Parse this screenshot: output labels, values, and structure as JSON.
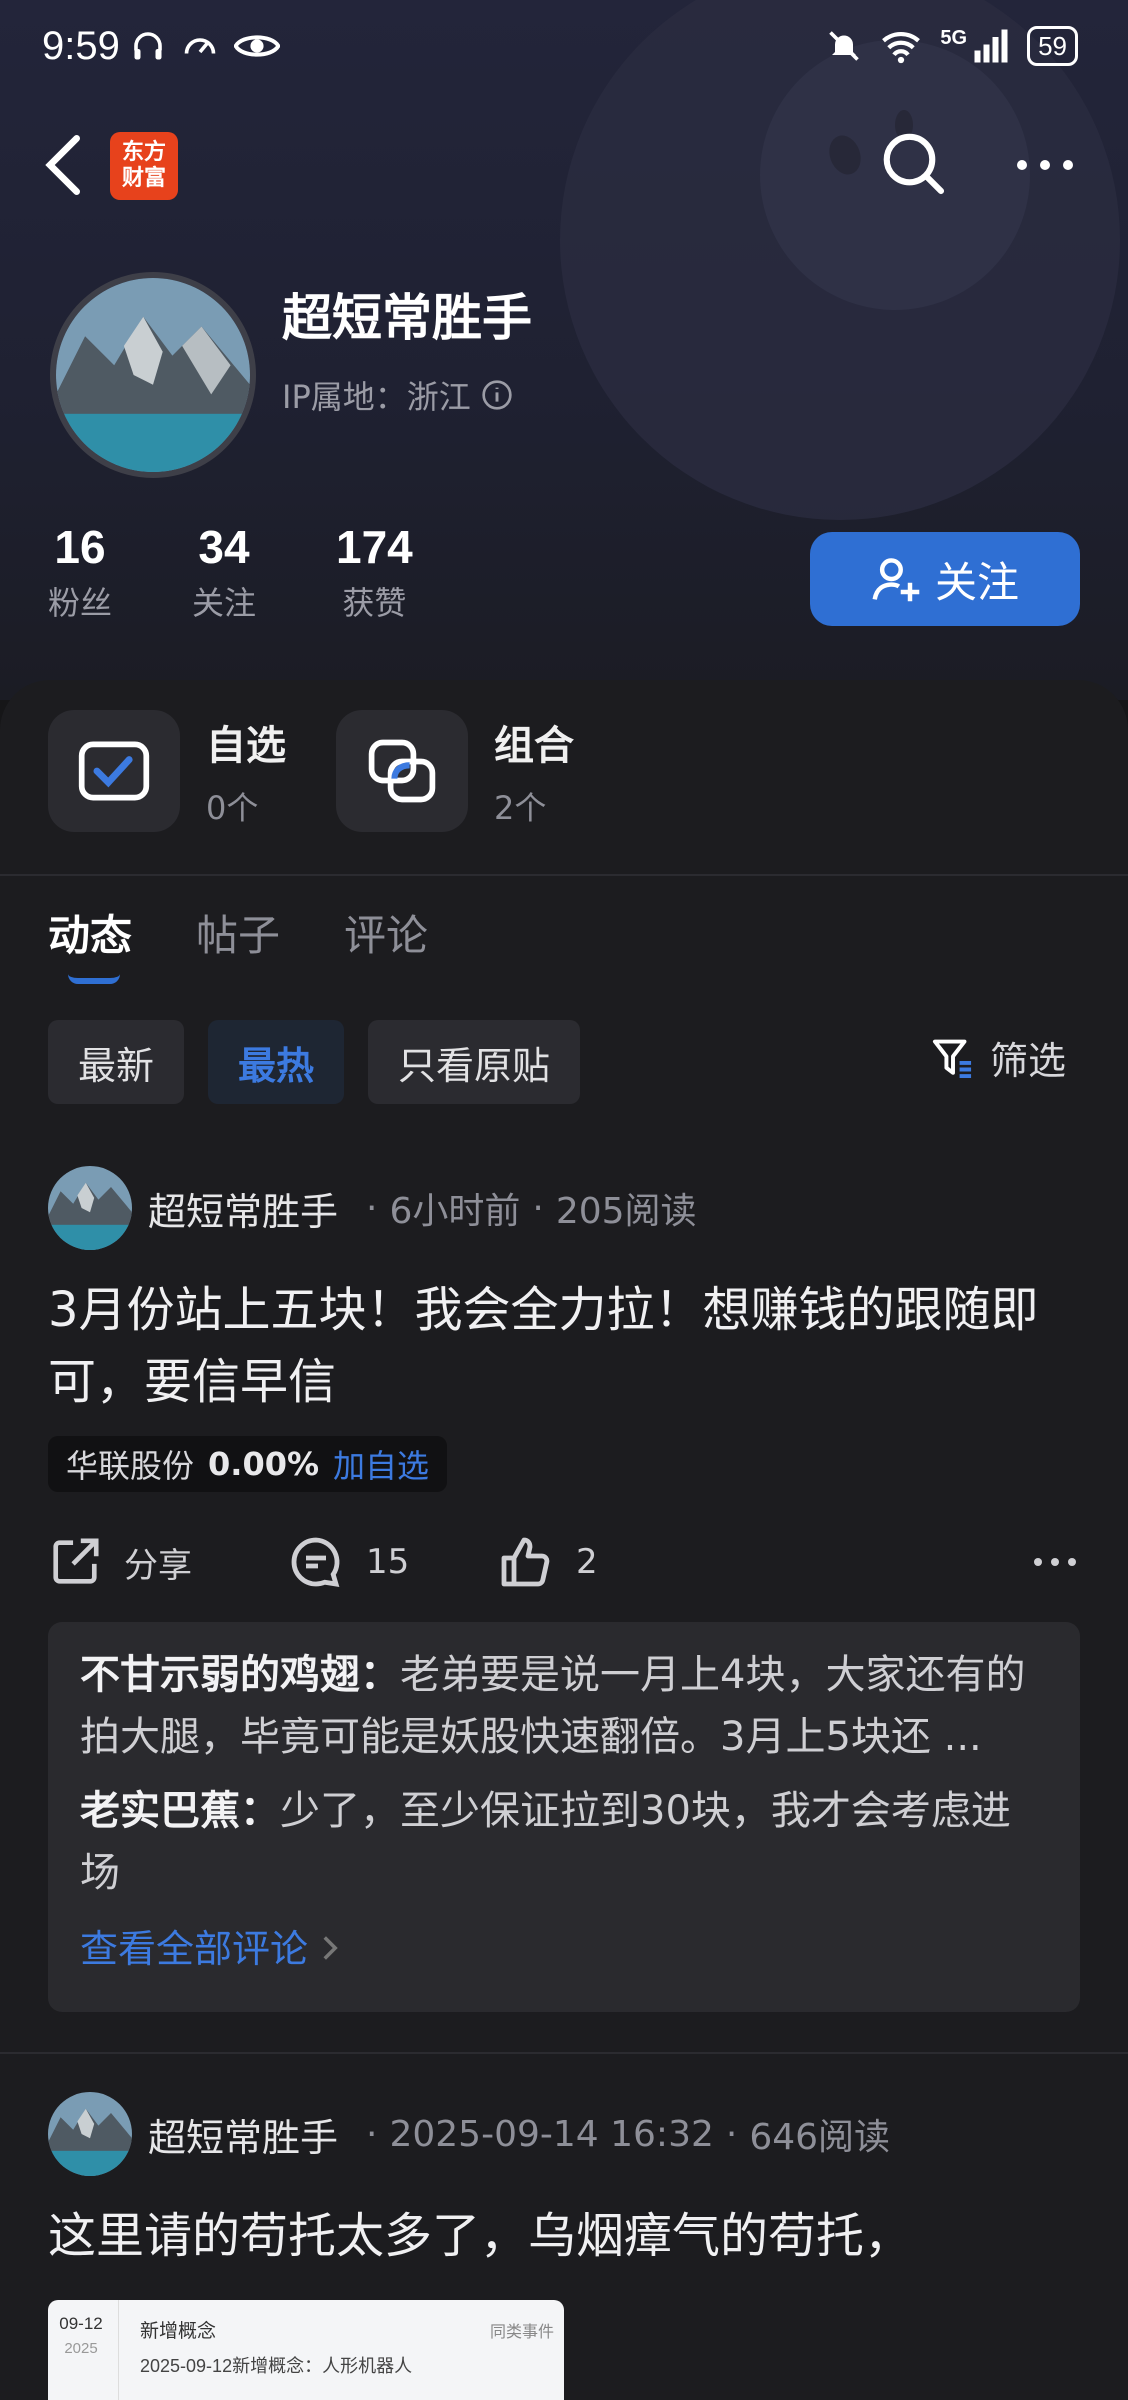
{
  "status_bar": {
    "time": "9:59",
    "network": "5G",
    "battery": "59"
  },
  "header": {
    "logo_text_line1": "东方",
    "logo_text_line2": "财富"
  },
  "profile": {
    "name": "超短常胜手",
    "ip_location": "IP属地：浙江",
    "stats": [
      {
        "value": "16",
        "label": "粉丝"
      },
      {
        "value": "34",
        "label": "关注"
      },
      {
        "value": "174",
        "label": "获赞"
      }
    ],
    "follow_label": "关注"
  },
  "quick_links": [
    {
      "title": "自选",
      "sub": "0个"
    },
    {
      "title": "组合",
      "sub": "2个"
    }
  ],
  "tabs": [
    {
      "label": "动态",
      "active": true
    },
    {
      "label": "帖子",
      "active": false
    },
    {
      "label": "评论",
      "active": false
    }
  ],
  "filters": {
    "chips": [
      {
        "label": "最新",
        "active": false
      },
      {
        "label": "最热",
        "active": true
      },
      {
        "label": "只看原贴",
        "active": false
      }
    ],
    "filter_label": "筛选"
  },
  "posts": [
    {
      "author": "超短常胜手",
      "time": "6小时前",
      "reads": "205阅读",
      "text": "3月份站上五块！我会全力拉！想赚钱的跟随即可，要信早信",
      "stock": {
        "name": "华联股份",
        "pct": "0.00%",
        "add_label": "加自选"
      },
      "share_label": "分享",
      "comments_count": "15",
      "likes_count": "2",
      "comments": [
        {
          "author": "不甘示弱的鸡翅：",
          "text": "老弟要是说一月上4块，大家还有的拍大腿，毕竟可能是妖股快速翻倍。3月上5块还 ..."
        },
        {
          "author": "老实巴蕉：",
          "text": "少了，至少保证拉到30块，我才会考虑进场"
        }
      ],
      "see_all_label": "查看全部评论"
    },
    {
      "author": "超短常胜手",
      "time": "2025-09-14 16:32",
      "reads": "646阅读",
      "text": "这里请的苟托太多了，乌烟瘴气的苟托，",
      "preview": {
        "date_top": "09-12",
        "date_year": "2025",
        "title": "新增概念",
        "subtitle": "2025-09-12新增概念：人形机器人",
        "tag": "同类事件"
      }
    }
  ],
  "colors": {
    "accent": "#2f6fd3",
    "link": "#3c7ae0",
    "logo": "#e7421c"
  }
}
